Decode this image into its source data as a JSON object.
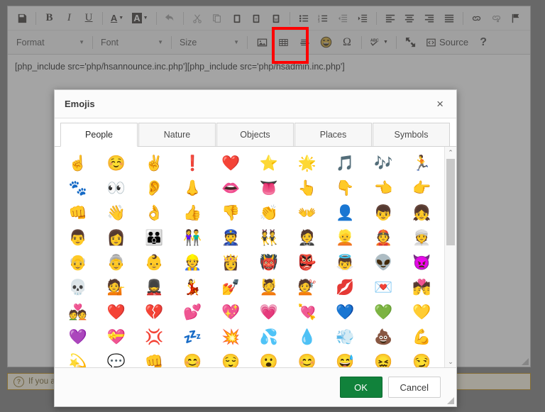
{
  "editor": {
    "toolbar_row1": [
      {
        "name": "save-button",
        "glyph": "save",
        "dim": false
      },
      {
        "name": "separator",
        "glyph": "sep",
        "dim": false
      },
      {
        "name": "bold-button",
        "glyph": "B",
        "dim": false
      },
      {
        "name": "italic-button",
        "glyph": "I",
        "dim": false
      },
      {
        "name": "underline-button",
        "glyph": "U",
        "dim": false
      },
      {
        "name": "separator",
        "glyph": "sep",
        "dim": false
      },
      {
        "name": "text-color-button",
        "glyph": "A-color",
        "dim": false
      },
      {
        "name": "background-color-button",
        "glyph": "A-bg",
        "dim": false
      },
      {
        "name": "separator",
        "glyph": "sep",
        "dim": false
      },
      {
        "name": "undo-button",
        "glyph": "undo",
        "dim": true
      },
      {
        "name": "separator",
        "glyph": "sep",
        "dim": false
      },
      {
        "name": "cut-button",
        "glyph": "cut",
        "dim": true
      },
      {
        "name": "copy-button",
        "glyph": "copy",
        "dim": true
      },
      {
        "name": "paste-button",
        "glyph": "paste",
        "dim": false
      },
      {
        "name": "paste-as-text-button",
        "glyph": "paste-text",
        "dim": false
      },
      {
        "name": "paste-from-word-button",
        "glyph": "paste-word",
        "dim": false
      },
      {
        "name": "separator",
        "glyph": "sep",
        "dim": false
      },
      {
        "name": "bulleted-list-button",
        "glyph": "ul",
        "dim": false
      },
      {
        "name": "numbered-list-button",
        "glyph": "ol",
        "dim": false
      },
      {
        "name": "decrease-indent-button",
        "glyph": "outdent",
        "dim": true
      },
      {
        "name": "increase-indent-button",
        "glyph": "indent",
        "dim": false
      },
      {
        "name": "separator",
        "glyph": "sep",
        "dim": false
      },
      {
        "name": "align-left-button",
        "glyph": "align-left",
        "dim": false
      },
      {
        "name": "align-center-button",
        "glyph": "align-center",
        "dim": false
      },
      {
        "name": "align-right-button",
        "glyph": "align-right",
        "dim": false
      },
      {
        "name": "align-justify-button",
        "glyph": "align-justify",
        "dim": false
      },
      {
        "name": "separator",
        "glyph": "sep",
        "dim": false
      },
      {
        "name": "link-button",
        "glyph": "link",
        "dim": false
      },
      {
        "name": "unlink-button",
        "glyph": "unlink",
        "dim": true
      },
      {
        "name": "anchor-button",
        "glyph": "flag",
        "dim": false
      }
    ],
    "dropdowns": {
      "format": "Format",
      "font": "Font",
      "size": "Size"
    },
    "toolbar_row2": [
      {
        "name": "insert-image-button",
        "glyph": "image",
        "dim": false
      },
      {
        "name": "insert-table-button",
        "glyph": "table",
        "dim": false
      },
      {
        "name": "horizontal-rule-button",
        "glyph": "hr",
        "dim": false
      },
      {
        "name": "insert-emoji-button",
        "glyph": "emoji",
        "dim": false
      },
      {
        "name": "special-character-button",
        "glyph": "omega",
        "dim": false
      },
      {
        "name": "separator",
        "glyph": "sep",
        "dim": false
      },
      {
        "name": "spellcheck-button",
        "glyph": "abc",
        "dim": false
      },
      {
        "name": "separator",
        "glyph": "sep",
        "dim": false
      },
      {
        "name": "maximize-button",
        "glyph": "maximize",
        "dim": false
      },
      {
        "name": "source-button",
        "glyph": "source",
        "dim": false
      },
      {
        "name": "help-button",
        "glyph": "help",
        "dim": false
      }
    ],
    "source_label": "Source",
    "content_text": "[php_include src='php/hsannounce.inc.php'][php_include src='php/hsadmin.inc.php']"
  },
  "status": {
    "text": "If you are",
    "icon": "question-circle-icon"
  },
  "dialog": {
    "title": "Emojis",
    "close_label": "×",
    "tabs": [
      {
        "label": "People",
        "active": true
      },
      {
        "label": "Nature",
        "active": false
      },
      {
        "label": "Objects",
        "active": false
      },
      {
        "label": "Places",
        "active": false
      },
      {
        "label": "Symbols",
        "active": false
      }
    ],
    "emojis": [
      "☝️",
      "☺️",
      "✌️",
      "❗",
      "❤️",
      "⭐",
      "🌟",
      "🎵",
      "🎶",
      "🏃",
      "🐾",
      "👀",
      "👂",
      "👃",
      "👄",
      "👅",
      "👆",
      "👇",
      "👈",
      "👉",
      "👊",
      "👋",
      "👌",
      "👍",
      "👎",
      "👏",
      "👐",
      "👤",
      "👦",
      "👧",
      "👨",
      "👩",
      "👪",
      "👫",
      "👮",
      "👯",
      "🤵",
      "👱",
      "👲",
      "👳",
      "👴",
      "👵",
      "👶",
      "👷",
      "👸",
      "👹",
      "👺",
      "👼",
      "👽",
      "👿",
      "💀",
      "💁",
      "💂",
      "💃",
      "💅",
      "💆",
      "💇",
      "💋",
      "💌",
      "💏",
      "💑",
      "❤️",
      "💔",
      "💕",
      "💖",
      "💗",
      "💘",
      "💙",
      "💚",
      "💛",
      "💜",
      "💝",
      "💢",
      "💤",
      "💥",
      "💦",
      "💧",
      "💨",
      "💩",
      "💪",
      "💫",
      "💬",
      "👊",
      "😊",
      "😌",
      "😮",
      "😊",
      "😅",
      "😖",
      "😏"
    ],
    "scrollbar": {
      "up_arrow": "⌃",
      "down_arrow": "⌄"
    },
    "buttons": {
      "ok": "OK",
      "cancel": "Cancel"
    }
  },
  "colors": {
    "ok_button": "#11823b",
    "highlight_box": "#ff0000",
    "page_background": "#7b7b7b",
    "dialog_background": "#ffffff"
  }
}
